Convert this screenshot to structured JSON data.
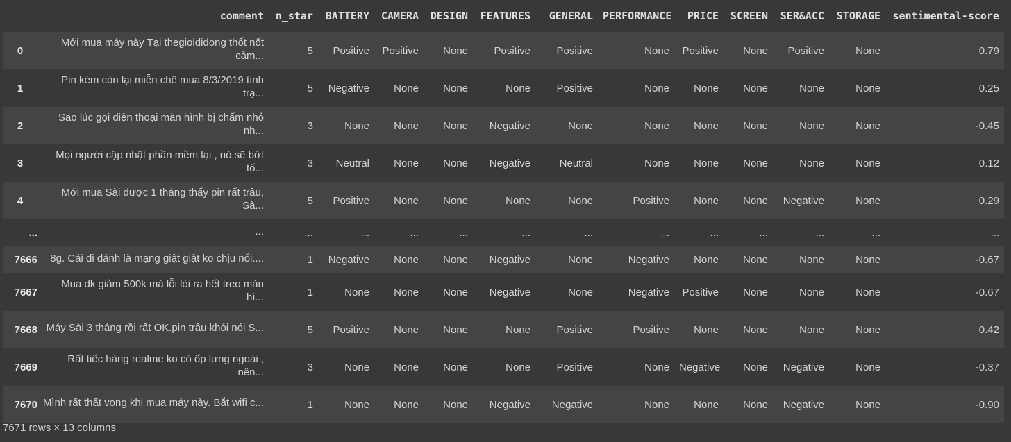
{
  "table": {
    "columns": [
      "comment",
      "n_star",
      "BATTERY",
      "CAMERA",
      "DESIGN",
      "FEATURES",
      "GENERAL",
      "PERFORMANCE",
      "PRICE",
      "SCREEN",
      "SER&ACC",
      "STORAGE",
      "sentimental-score"
    ],
    "rows": [
      {
        "index": "0",
        "cells": [
          "Mới mua máy này Tại thegioididong thốt nốt cảm...",
          "5",
          "Positive",
          "Positive",
          "None",
          "Positive",
          "Positive",
          "None",
          "Positive",
          "None",
          "Positive",
          "None",
          "0.79"
        ]
      },
      {
        "index": "1",
        "cells": [
          "Pin kém còn lại miễn chê mua 8/3/2019 tình trạ...",
          "5",
          "Negative",
          "None",
          "None",
          "None",
          "Positive",
          "None",
          "None",
          "None",
          "None",
          "None",
          "0.25"
        ]
      },
      {
        "index": "2",
        "cells": [
          "Sao lúc gọi điện thoại màn hình bị chấm nhỏ nh...",
          "3",
          "None",
          "None",
          "None",
          "Negative",
          "None",
          "None",
          "None",
          "None",
          "None",
          "None",
          "-0.45"
        ]
      },
      {
        "index": "3",
        "cells": [
          "Mọi người cập nhật phần mềm lại , nó sẽ bớt tố...",
          "3",
          "Neutral",
          "None",
          "None",
          "Negative",
          "Neutral",
          "None",
          "None",
          "None",
          "None",
          "None",
          "0.12"
        ]
      },
      {
        "index": "4",
        "cells": [
          "Mới mua Sài được 1 tháng thấy pin rất trâu, Sà...",
          "5",
          "Positive",
          "None",
          "None",
          "None",
          "None",
          "Positive",
          "None",
          "None",
          "Negative",
          "None",
          "0.29"
        ]
      },
      {
        "index": "...",
        "cells": [
          "...",
          "...",
          "...",
          "...",
          "...",
          "...",
          "...",
          "...",
          "...",
          "...",
          "...",
          "...",
          "..."
        ]
      },
      {
        "index": "7666",
        "cells": [
          "8g. Cái đi đánh là mạng giật giật ko chịu nổi....",
          "1",
          "Negative",
          "None",
          "None",
          "Negative",
          "None",
          "Negative",
          "None",
          "None",
          "None",
          "None",
          "-0.67"
        ]
      },
      {
        "index": "7667",
        "cells": [
          "Mua dk giảm 500k mà lỗi lòi ra hết treo màn hì...",
          "1",
          "None",
          "None",
          "None",
          "Negative",
          "None",
          "Negative",
          "Positive",
          "None",
          "None",
          "None",
          "-0.67"
        ]
      },
      {
        "index": "7668",
        "cells": [
          "Máy Sài 3 tháng rồi rất OK.pin trâu khỏi nói S...",
          "5",
          "Positive",
          "None",
          "None",
          "None",
          "Positive",
          "Positive",
          "None",
          "None",
          "None",
          "None",
          "0.42"
        ]
      },
      {
        "index": "7669",
        "cells": [
          "Rất tiếc hàng realme ko có ốp lưng ngoài , nên...",
          "3",
          "None",
          "None",
          "None",
          "None",
          "Positive",
          "None",
          "Negative",
          "None",
          "Negative",
          "None",
          "-0.37"
        ]
      },
      {
        "index": "7670",
        "cells": [
          "Mình rất thất vọng khi mua máy này. Bắt wifi c...",
          "1",
          "None",
          "None",
          "None",
          "Negative",
          "Negative",
          "None",
          "None",
          "None",
          "Negative",
          "None",
          "-0.90"
        ]
      }
    ],
    "footer": "7671 rows × 13 columns"
  }
}
